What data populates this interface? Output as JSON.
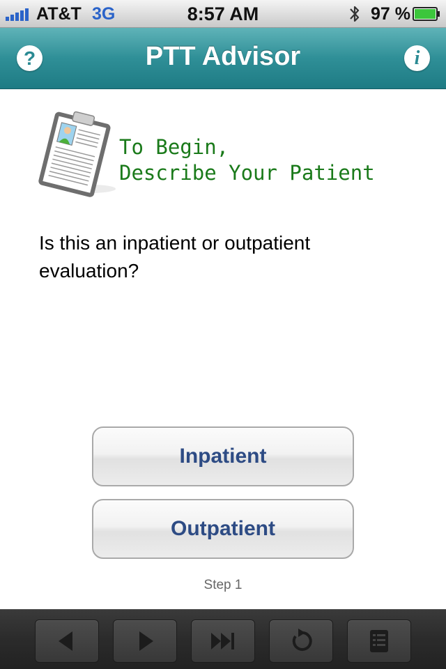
{
  "status_bar": {
    "carrier": "AT&T",
    "network": "3G",
    "time": "8:57 AM",
    "battery": "97 %",
    "icons": [
      "signal-bars-icon",
      "bluetooth-icon",
      "battery-icon"
    ]
  },
  "nav": {
    "title": "PTT Advisor",
    "help_glyph": "?",
    "info_glyph": "i"
  },
  "intro": {
    "line1": "To Begin,",
    "line2": "Describe Your Patient",
    "icon": "clipboard-patient-icon"
  },
  "question": "Is this an inpatient or outpatient evaluation?",
  "choices": {
    "inpatient": "Inpatient",
    "outpatient": "Outpatient"
  },
  "step_label": "Step 1",
  "toolbar": {
    "buttons": [
      "back-icon",
      "forward-icon",
      "skip-forward-icon",
      "restart-icon",
      "list-icon"
    ]
  },
  "colors": {
    "nav_bar": "#2f8f97",
    "intro_text": "#1a7a1a",
    "button_text": "#2d4b84",
    "toolbar": "#2b2b2b"
  }
}
